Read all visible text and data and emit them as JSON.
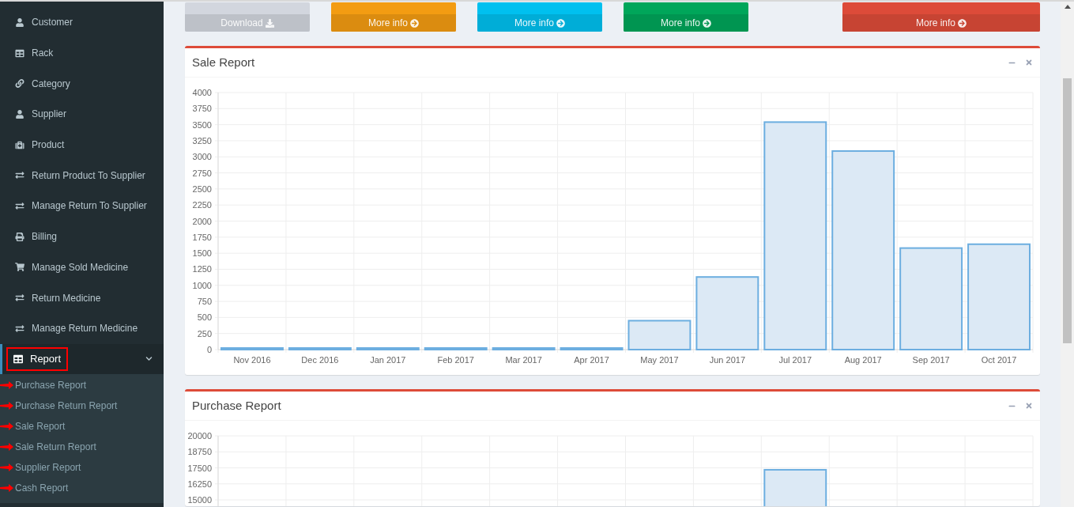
{
  "sidebar": {
    "items": [
      {
        "label": "Customer",
        "kind": "user",
        "selected": false
      },
      {
        "label": "Rack",
        "kind": "table",
        "selected": false
      },
      {
        "label": "Category",
        "kind": "link",
        "selected": false
      },
      {
        "label": "Supplier",
        "kind": "user",
        "selected": false
      },
      {
        "label": "Product",
        "kind": "medkit",
        "selected": false
      },
      {
        "label": "Return Product To Supplier",
        "kind": "exchange",
        "selected": false
      },
      {
        "label": "Manage Return To Supplier",
        "kind": "exchange",
        "selected": false
      },
      {
        "label": "Billing",
        "kind": "print",
        "selected": false
      },
      {
        "label": "Manage Sold Medicine",
        "kind": "cart",
        "selected": false
      },
      {
        "label": "Return Medicine",
        "kind": "exchange",
        "selected": false
      },
      {
        "label": "Manage Return Medicine",
        "kind": "exchange",
        "selected": false
      },
      {
        "label": "Report",
        "kind": "table",
        "selected": true,
        "expanded": true,
        "children": [
          {
            "label": "Purchase Report"
          },
          {
            "label": "Purchase Return Report"
          },
          {
            "label": "Sale Report"
          },
          {
            "label": "Sale Return Report"
          },
          {
            "label": "Supplier Report"
          },
          {
            "label": "Cash Report"
          }
        ]
      }
    ]
  },
  "info_boxes": [
    {
      "footer": "Download",
      "kind": "download",
      "color": "#d2d6de"
    },
    {
      "footer": "More info",
      "kind": "link",
      "color": "#f39c12"
    },
    {
      "footer": "More info",
      "kind": "link",
      "color": "#00c0ef"
    },
    {
      "footer": "More info",
      "kind": "link",
      "color": "#00a65a"
    },
    {
      "footer": "More info",
      "kind": "link",
      "color": "#dd4b39"
    }
  ],
  "panels": [
    {
      "title": "Sale Report",
      "chart_data": {
        "type": "bar",
        "grid": true,
        "categories": [
          "Nov 2016",
          "Dec 2016",
          "Jan 2017",
          "Feb 2017",
          "Mar 2017",
          "Apr 2017",
          "May 2017",
          "Jun 2017",
          "Jul 2017",
          "Aug 2017",
          "Sep 2017",
          "Oct 2017"
        ],
        "values": [
          0,
          0,
          0,
          0,
          0,
          0,
          450,
          1130,
          3540,
          3090,
          1580,
          1640
        ],
        "ylim": [
          0,
          4000
        ],
        "yticks": [
          0,
          250,
          500,
          750,
          1000,
          1250,
          1500,
          1750,
          2000,
          2250,
          2500,
          2750,
          3000,
          3250,
          3500,
          3750,
          4000
        ]
      }
    },
    {
      "title": "Purchase Report",
      "chart_data": {
        "type": "bar",
        "grid": true,
        "values": [
          null,
          null,
          null,
          null,
          null,
          null,
          null,
          null,
          17350,
          null,
          null,
          null
        ],
        "ylim": [
          15000,
          20000
        ],
        "yticks": [
          15000,
          16250,
          17500,
          18750,
          20000
        ]
      }
    }
  ]
}
